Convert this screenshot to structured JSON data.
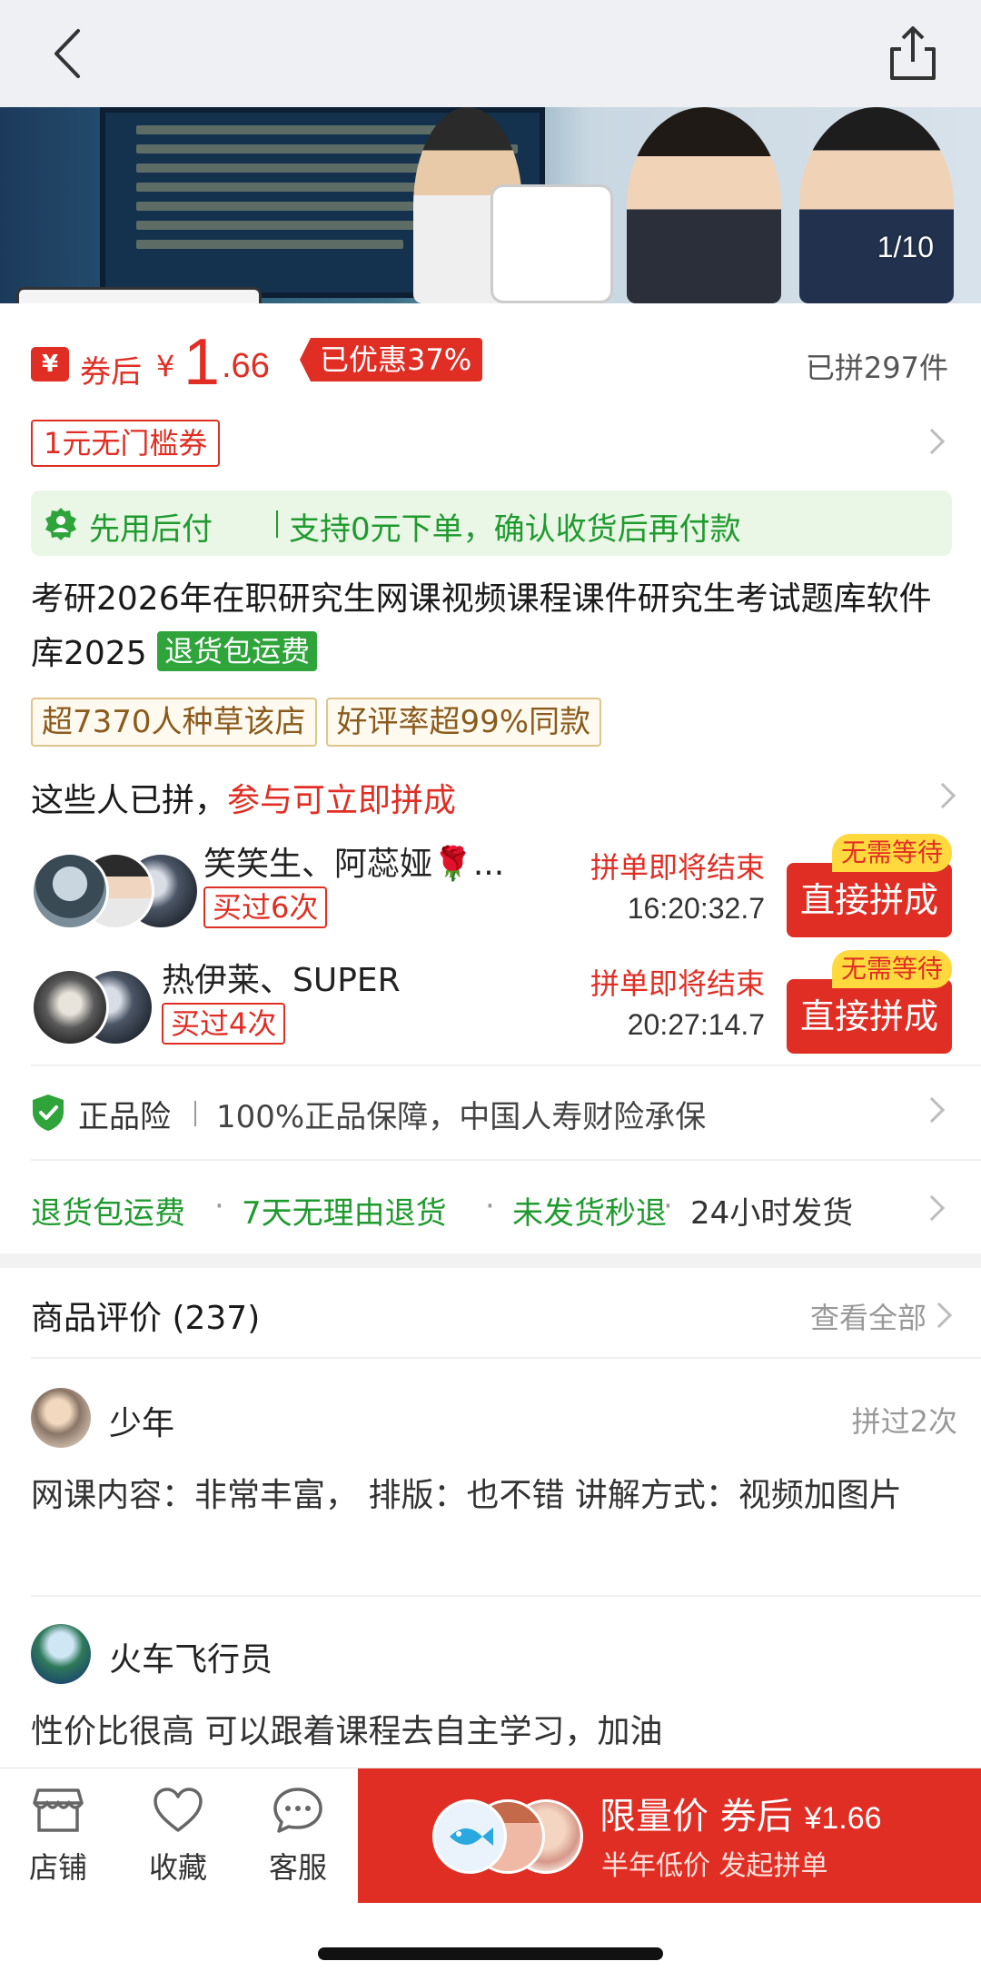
{
  "nav": {
    "back_icon": "chevron-left-icon",
    "share_icon": "share-icon"
  },
  "banner": {
    "page_indicator": "1/10"
  },
  "price": {
    "after_coupon_label": "券后",
    "currency": "¥",
    "integer": "1",
    "decimal": ".66",
    "discount_label": "已优惠37%",
    "sold_count": "已拼297件"
  },
  "coupon": {
    "label": "1元无门槛券"
  },
  "pay_later": {
    "title": "先用后付",
    "description": "支持0元下单，确认收货后再付款",
    "color": "#1f9a2e"
  },
  "product": {
    "title": "考研2026年在职研究生网课视频课程课件研究生考试题库软件库2025",
    "free_return_tag": "退货包运费"
  },
  "store_tags": [
    "超7370人种草该店",
    "好评率超99%同款"
  ],
  "group_buy": {
    "header_static": "这些人已拼，",
    "header_highlight": "参与可立即拼成",
    "groups": [
      {
        "names": "笑笑生、阿蕊娅🌹...",
        "bought": "买过6次",
        "ending_label": "拼单即将结束",
        "timer": "16:20:32.7",
        "badge": "无需等待",
        "button": "直接拼成"
      },
      {
        "names": "热伊莱、SUPER",
        "bought": "买过4次",
        "ending_label": "拼单即将结束",
        "timer": "20:27:14.7",
        "badge": "无需等待",
        "button": "直接拼成"
      }
    ]
  },
  "guarantee": {
    "title": "正品险",
    "description": "100%正品保障，中国人寿财险承保"
  },
  "services": {
    "items": [
      "退货包运费",
      "7天无理由退货",
      "未发货秒退",
      "24小时发货"
    ],
    "separator": "·"
  },
  "reviews": {
    "header_title": "商品评价 (237)",
    "see_all": "查看全部",
    "items": [
      {
        "name": "少年",
        "meta": "拼过2次",
        "text": "网课内容：非常丰富， 排版：也不错 讲解方式：视频加图片"
      },
      {
        "name": "火车飞行员",
        "meta": "",
        "text": "性价比很高 可以跟着课程去自主学习，加油"
      }
    ]
  },
  "bottom_bar": {
    "tabs": [
      {
        "label": "店铺",
        "icon": "store-icon"
      },
      {
        "label": "收藏",
        "icon": "heart-icon"
      },
      {
        "label": "客服",
        "icon": "chat-icon"
      }
    ],
    "cta_main": "限量价 券后",
    "cta_price": "¥1.66",
    "cta_sub": "半年低价 发起拼单"
  },
  "colors": {
    "brand_red": "#e02e24",
    "green": "#1f9a2e",
    "gold_border": "#e0c48a"
  }
}
